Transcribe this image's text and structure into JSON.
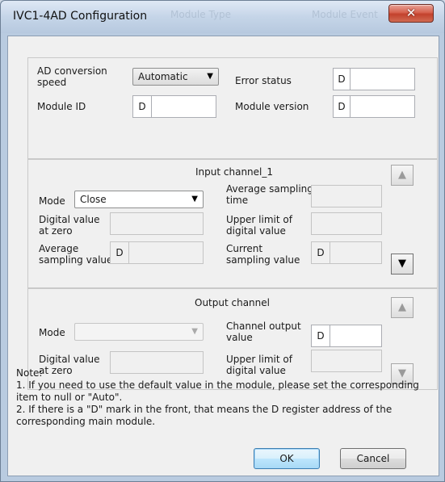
{
  "window": {
    "title": "IVC1-4AD Configuration",
    "close_glyph": "✕",
    "bg_ghost_1": "Module Type",
    "bg_ghost_2": "Module Event"
  },
  "general": {
    "ad_speed_label": "AD conversion speed",
    "ad_speed_value": "Automatic",
    "error_status_label": "Error status",
    "error_status_prefix": "D",
    "error_status_value": "",
    "module_id_label": "Module ID",
    "module_id_prefix": "D",
    "module_id_value": "",
    "module_version_label": "Module version",
    "module_version_prefix": "D",
    "module_version_value": ""
  },
  "input_channel": {
    "title": "Input channel_1",
    "mode_label": "Mode",
    "mode_value": "Close",
    "avg_time_label": "Average sampling time",
    "digital_zero_label": "Digital value at zero",
    "upper_limit_label": "Upper limit of digital value",
    "avg_value_label": "Average sampling value",
    "avg_value_prefix": "D",
    "current_value_label": "Current sampling value",
    "current_value_prefix": "D",
    "up_arrow": "▲",
    "down_arrow": "▼"
  },
  "output_channel": {
    "title": "Output channel",
    "mode_label": "Mode",
    "mode_value": "",
    "channel_output_label": "Channel output value",
    "channel_output_prefix": "D",
    "digital_zero_label": "Digital value at zero",
    "upper_limit_label": "Upper limit of digital value",
    "up_arrow": "▲",
    "down_arrow": "▼"
  },
  "note": {
    "heading": "Note:",
    "line1": "1. If you need to use the default value in the module, please set the corresponding item to null or \"Auto\".",
    "line2": "2. If there is a \"D\" mark in the front, that means the D register address of the corresponding main module."
  },
  "buttons": {
    "ok": "OK",
    "cancel": "Cancel"
  },
  "icons": {
    "close": "close-icon",
    "up": "up-arrow-icon",
    "down": "down-arrow-icon",
    "dropdown": "chevron-down-icon"
  }
}
